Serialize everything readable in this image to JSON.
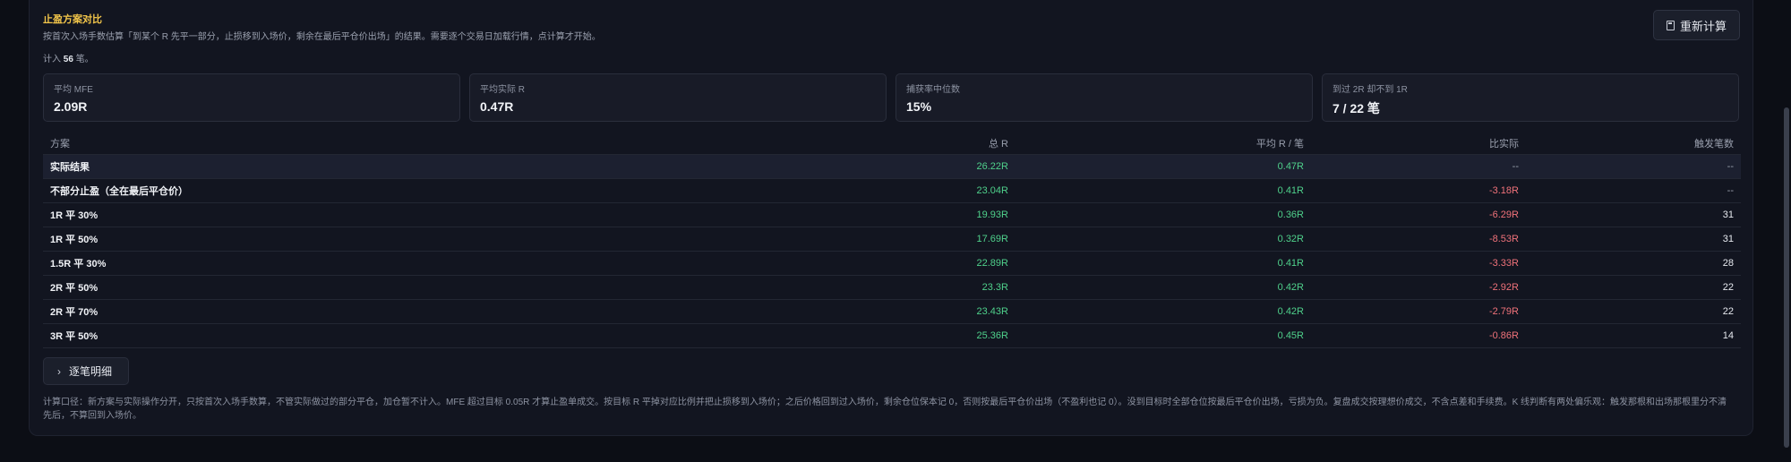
{
  "header": {
    "title": "止盈方案对比",
    "description": "按首次入场手数估算「到某个 R 先平一部分，止损移到入场价，剩余在最后平仓价出场」的结果。需要逐个交易日加载行情，点计算才开始。",
    "count_prefix": "计入",
    "count_value": "56",
    "count_suffix": "笔。",
    "recalc_label": "重新计算"
  },
  "stats": [
    {
      "label": "平均 MFE",
      "value": "2.09R"
    },
    {
      "label": "平均实际 R",
      "value": "0.47R"
    },
    {
      "label": "捕获率中位数",
      "value": "15%"
    },
    {
      "label": "到过 2R 却不到 1R",
      "value": "7 / 22 笔"
    }
  ],
  "table": {
    "columns": [
      "方案",
      "总 R",
      "平均 R / 笔",
      "比实际",
      "触发笔数"
    ],
    "rows": [
      {
        "name": "实际结果",
        "total": "26.22R",
        "avg": "0.47R",
        "diff": "--",
        "trig": "--"
      },
      {
        "name": "不部分止盈（全在最后平仓价）",
        "total": "23.04R",
        "avg": "0.41R",
        "diff": "-3.18R",
        "trig": "--"
      },
      {
        "name": "1R 平 30%",
        "total": "19.93R",
        "avg": "0.36R",
        "diff": "-6.29R",
        "trig": "31"
      },
      {
        "name": "1R 平 50%",
        "total": "17.69R",
        "avg": "0.32R",
        "diff": "-8.53R",
        "trig": "31"
      },
      {
        "name": "1.5R 平 30%",
        "total": "22.89R",
        "avg": "0.41R",
        "diff": "-3.33R",
        "trig": "28"
      },
      {
        "name": "2R 平 50%",
        "total": "23.3R",
        "avg": "0.42R",
        "diff": "-2.92R",
        "trig": "22"
      },
      {
        "name": "2R 平 70%",
        "total": "23.43R",
        "avg": "0.42R",
        "diff": "-2.79R",
        "trig": "22"
      },
      {
        "name": "3R 平 50%",
        "total": "25.36R",
        "avg": "0.45R",
        "diff": "-0.86R",
        "trig": "14"
      }
    ]
  },
  "detail_label": "逐笔明细",
  "footnote": "计算口径：新方案与实际操作分开，只按首次入场手数算，不管实际做过的部分平仓，加仓暂不计入。MFE 超过目标 0.05R 才算止盈单成交。按目标 R 平掉对应比例并把止损移到入场价；之后价格回到过入场价，剩余仓位保本记 0，否则按最后平仓价出场（不盈利也记 0）。没到目标时全部仓位按最后平仓价出场，亏损为负。复盘成交按理想价成交，不含点差和手续费。K 线判断有两处偏乐观：触发那根和出场那根里分不清先后，不算回到入场价。",
  "colors": {
    "accent_title": "#f3c64a",
    "positive": "#4fd18b",
    "negative": "#f0727a"
  }
}
